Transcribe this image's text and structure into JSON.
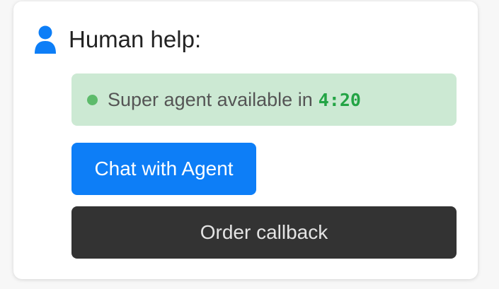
{
  "help": {
    "icon": "user-icon",
    "title": "Human help:",
    "status": {
      "text": "Super agent available in",
      "countdown": "4:20",
      "dot_color": "#5dbb6b",
      "background": "#cce9d3"
    },
    "chat_button": {
      "label": "Chat with Agent",
      "color": "#0d7ef7"
    },
    "callback_button": {
      "label": "Order callback",
      "color": "#333333"
    }
  }
}
